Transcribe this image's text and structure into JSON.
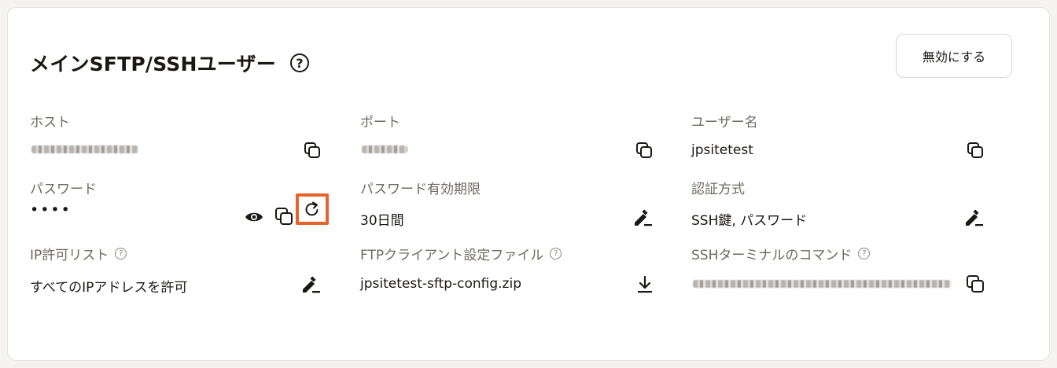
{
  "header": {
    "title": "メインSFTP/SSHユーザー",
    "help_icon": "?",
    "disable_button": "無効にする"
  },
  "fields": {
    "host": {
      "label": "ホスト"
    },
    "port": {
      "label": "ポート"
    },
    "username": {
      "label": "ユーザー名",
      "value": "jpsitetest"
    },
    "password": {
      "label": "パスワード",
      "value": "••••"
    },
    "password_expiry": {
      "label": "パスワード有効期限",
      "value": "30日間"
    },
    "auth_method": {
      "label": "認証方式",
      "value": "SSH鍵, パスワード"
    },
    "ip_allowlist": {
      "label": "IP許可リスト",
      "value": "すべてのIPアドレスを許可"
    },
    "ftp_config": {
      "label": "FTPクライアント設定ファイル",
      "value": "jpsitetest-sftp-config.zip"
    },
    "ssh_command": {
      "label": "SSHターミナルのコマンド"
    }
  },
  "help_small": "?",
  "colors": {
    "highlight": "#e8632c",
    "text": "#1b1715",
    "muted": "#6f6862"
  }
}
